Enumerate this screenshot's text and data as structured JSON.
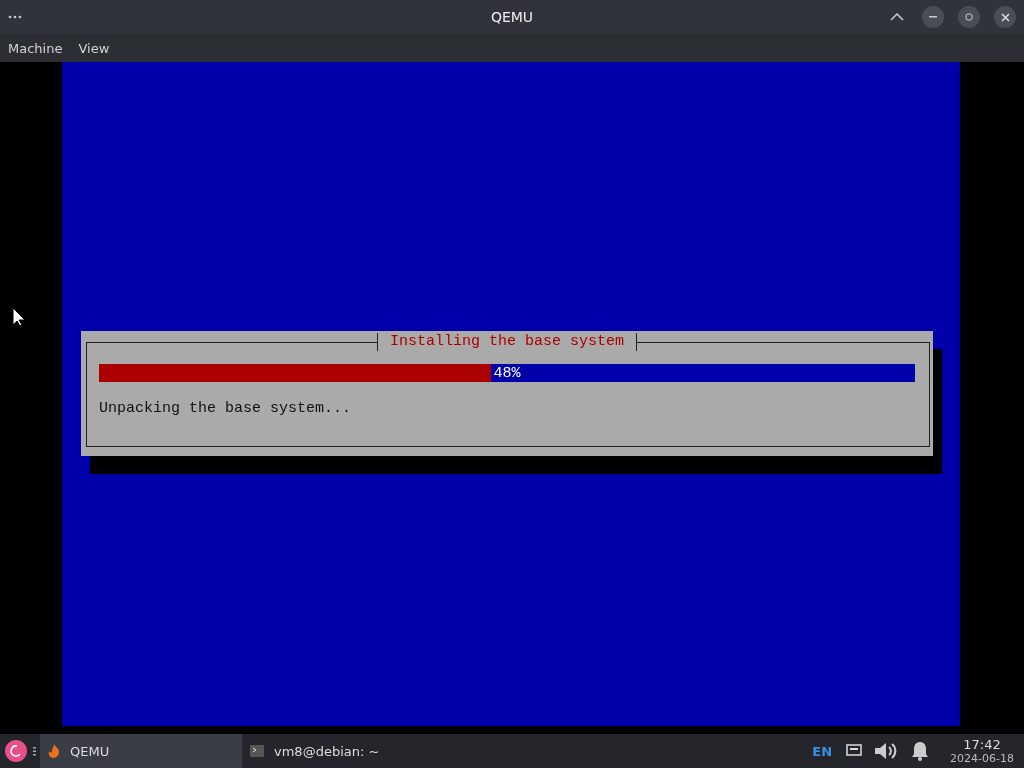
{
  "window": {
    "title": "QEMU"
  },
  "menu": [
    {
      "label": "Machine"
    },
    {
      "label": "View"
    }
  ],
  "installer": {
    "dialog_title": "Installing the base system",
    "progress": {
      "level": 0.48,
      "reading": "48%"
    },
    "status": "Unpacking the base system..."
  },
  "taskbar": {
    "items": [
      {
        "label": "QEMU",
        "selected": true,
        "kind": "qemu"
      },
      {
        "label": "vm8@debian: ~",
        "selected": false,
        "kind": "terminal"
      }
    ],
    "language": "EN",
    "clock": {
      "time": "17:42",
      "date": "2024-06-18"
    }
  }
}
